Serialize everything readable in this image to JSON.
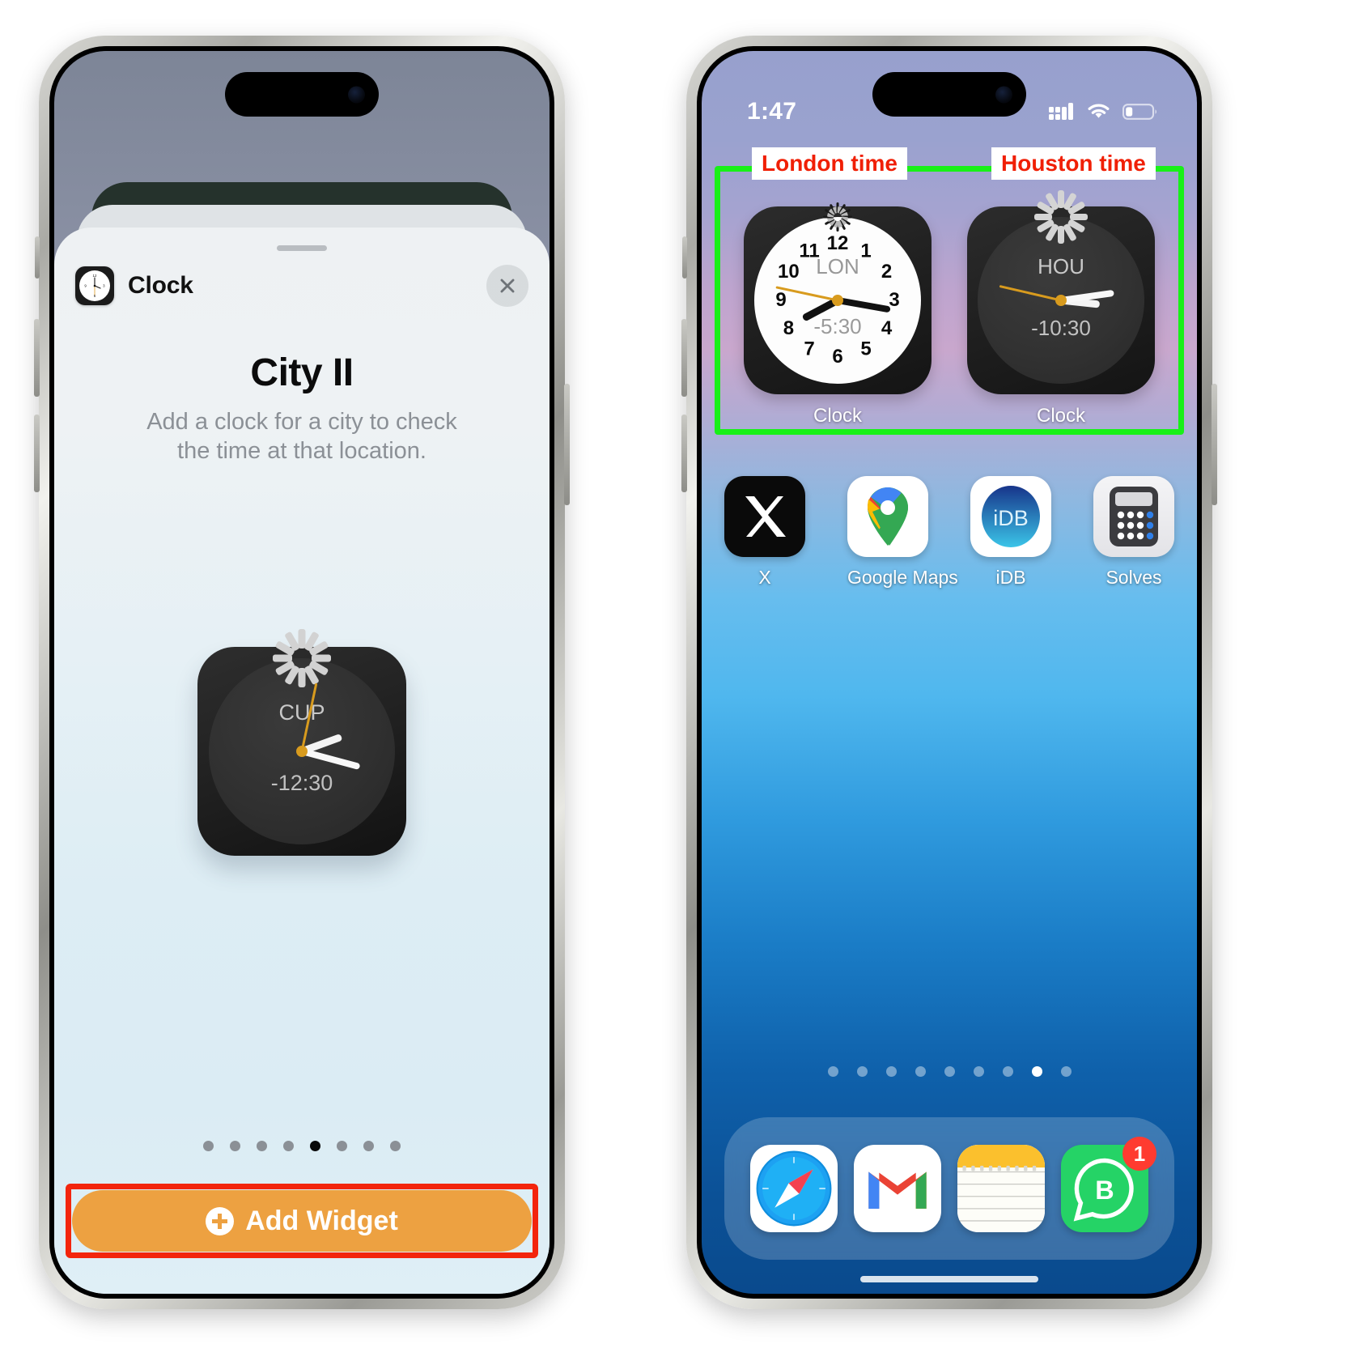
{
  "left_phone": {
    "sheet": {
      "app_name": "Clock",
      "close_icon": "close-icon",
      "title": "City II",
      "description": "Add a clock for a city to check the time at that location.",
      "widget_preview": {
        "city_code": "CUP",
        "offset": "-12:30",
        "style": "dark"
      },
      "page_dots": {
        "count": 8,
        "active_index": 4
      },
      "add_widget_button": {
        "label": "Add Widget",
        "icon": "plus-circle-icon",
        "color": "#eda141",
        "highlight_color": "#f3250d"
      }
    }
  },
  "right_phone": {
    "status_bar": {
      "time": "1:47",
      "cellular_icon": "cellular-bars-icon",
      "wifi_icon": "wifi-icon",
      "battery_icon": "battery-icon"
    },
    "annotations": {
      "left_tag": "London time",
      "right_tag": "Houston time",
      "highlight_color": "#18f018"
    },
    "widgets": [
      {
        "city_code": "LON",
        "offset": "-5:30",
        "caption": "Clock",
        "style": "light",
        "numerals": [
          "12",
          "1",
          "2",
          "3",
          "4",
          "5",
          "6",
          "7",
          "8",
          "9",
          "10",
          "11"
        ]
      },
      {
        "city_code": "HOU",
        "offset": "-10:30",
        "caption": "Clock",
        "style": "dark"
      }
    ],
    "apps": [
      {
        "label": "X",
        "icon": "x-app-icon"
      },
      {
        "label": "Google Maps",
        "icon": "google-maps-icon"
      },
      {
        "label": "iDB",
        "icon": "idb-app-icon"
      },
      {
        "label": "Solves",
        "icon": "calculator-app-icon"
      }
    ],
    "page_dots": {
      "count": 9,
      "active_index": 7
    },
    "dock": [
      {
        "label": "Safari",
        "icon": "safari-icon",
        "badge": ""
      },
      {
        "label": "Gmail",
        "icon": "gmail-icon",
        "badge": ""
      },
      {
        "label": "Notes",
        "icon": "notes-icon",
        "badge": ""
      },
      {
        "label": "WhatsApp Business",
        "icon": "whatsapp-business-icon",
        "badge": "1"
      }
    ]
  }
}
